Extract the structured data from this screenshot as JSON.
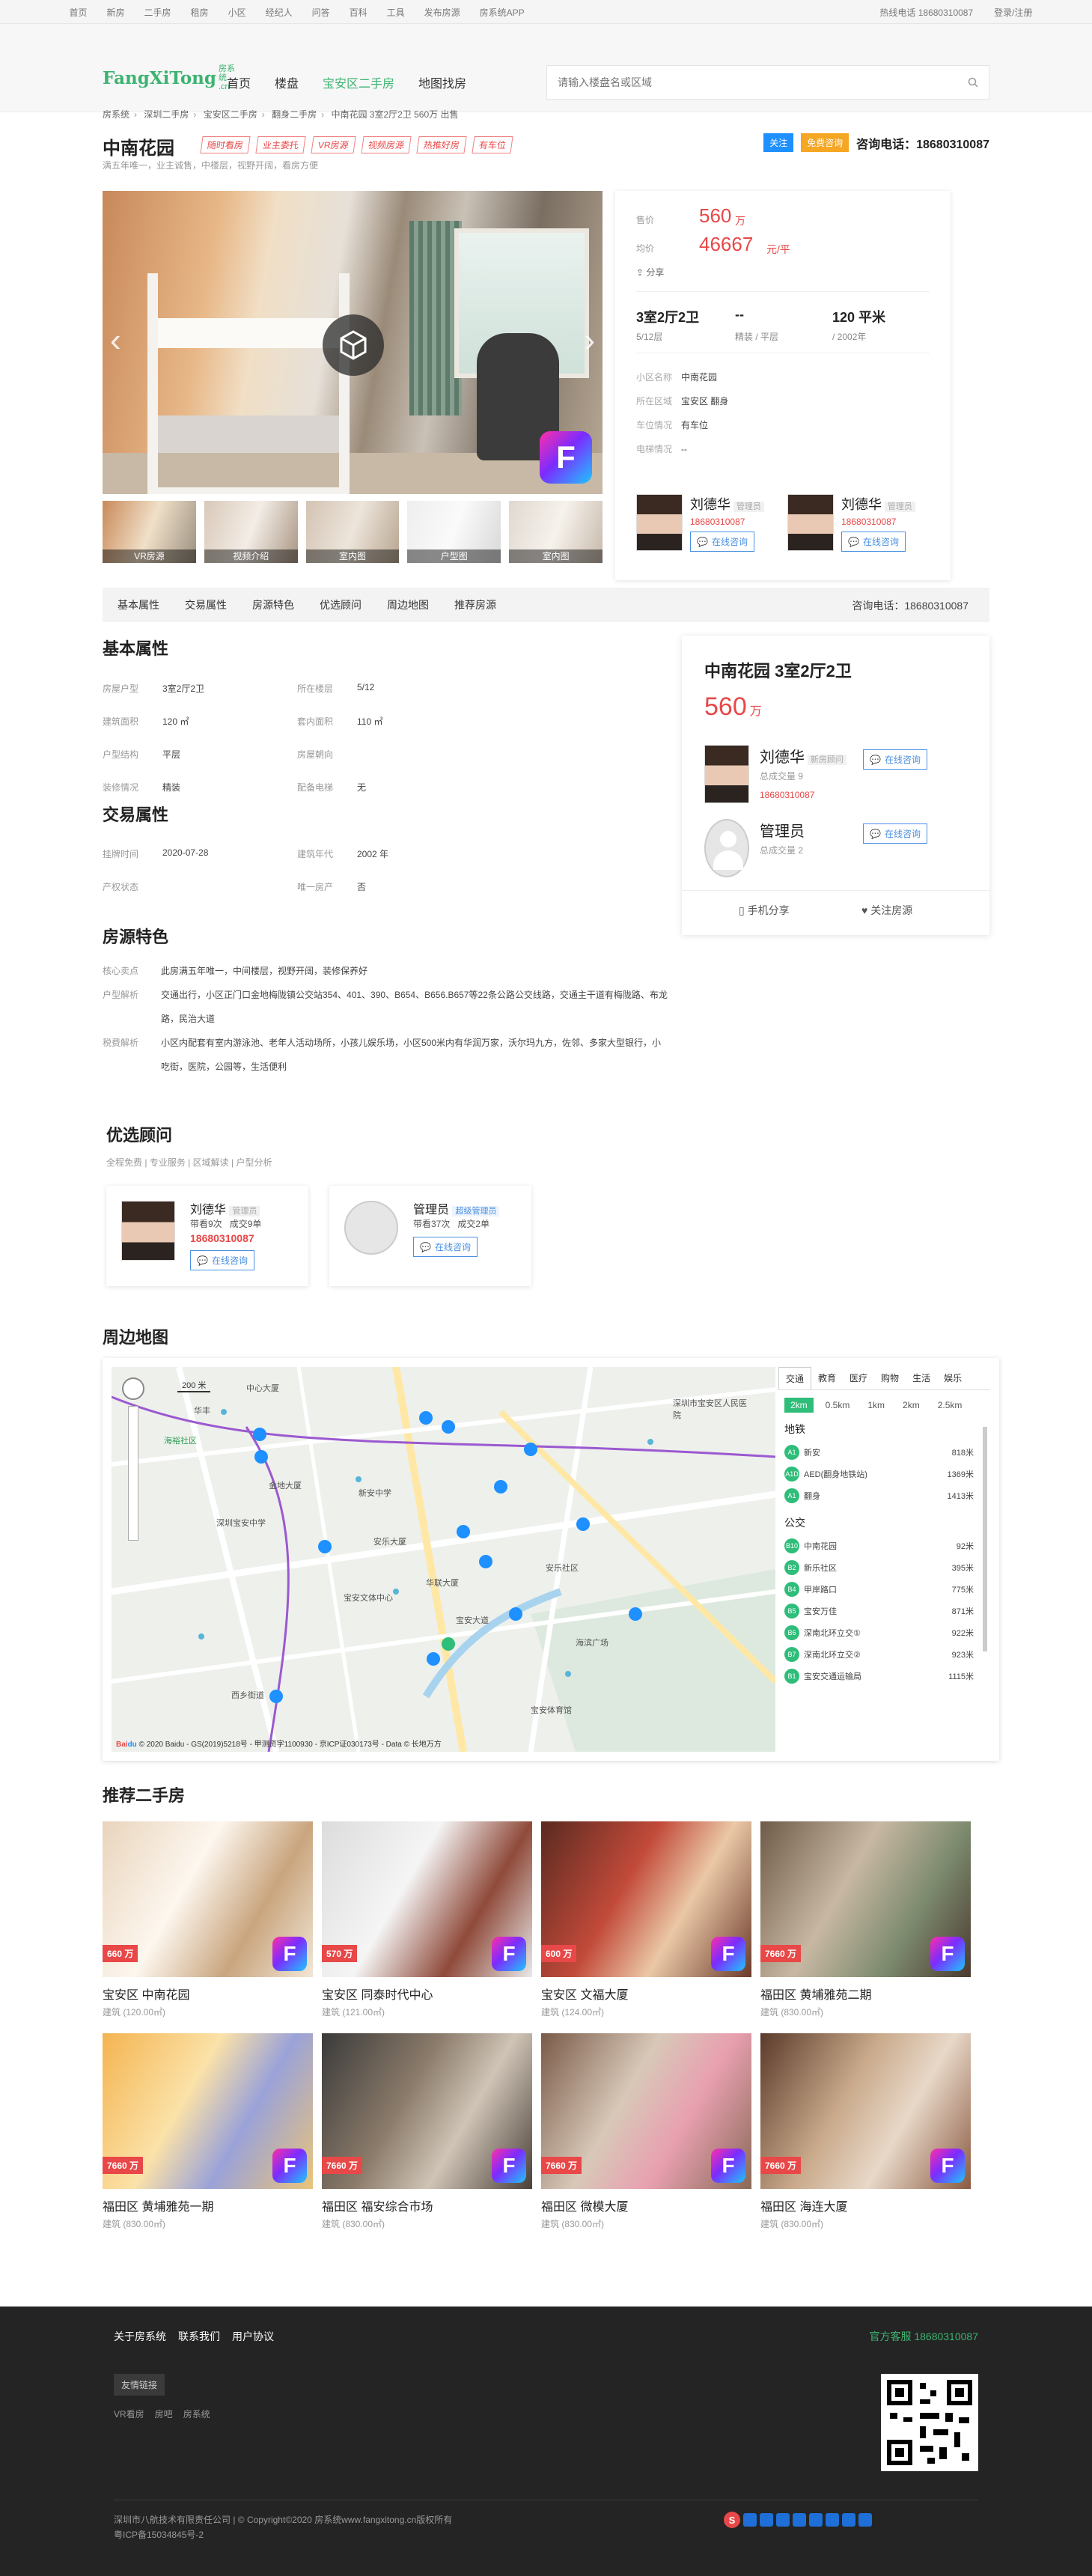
{
  "topbar": {
    "nav": [
      "首页",
      "新房",
      "二手房",
      "租房",
      "小区",
      "经纪人",
      "问答",
      "百科",
      "工具",
      "发布房源",
      "房系统APP"
    ],
    "hotline": "热线电话 18680310087",
    "login": "登录/注册"
  },
  "header": {
    "logo_text": "FangXiTong",
    "logo_cn": "房系统",
    "logo_cn_sub": ".cn",
    "nav": [
      "首页",
      "楼盘",
      "宝安区二手房",
      "地图找房"
    ],
    "search_placeholder": "请输入楼盘名或区域"
  },
  "breadcrumb": [
    "房系统",
    "深圳二手房",
    "宝安区二手房",
    "翻身二手房",
    "中南花园 3室2厅2卫 560万 出售"
  ],
  "title": {
    "name": "中南花园",
    "tags": [
      "随时看房",
      "业主委托",
      "VR房源",
      "视频房源",
      "热推好房",
      "有车位"
    ],
    "subtitle": "满五年唯一，业主诚售，中楼层，视野开阔，看房方便",
    "follow": "关注",
    "free_call": "免费咨询",
    "phone": "咨询电话：18680310087"
  },
  "gallery": {
    "thumbs": [
      "VR房源",
      "视频介绍",
      "室内图",
      "户型图",
      "室内图"
    ]
  },
  "info": {
    "price_label": "售价",
    "price": "560",
    "price_unit": "万",
    "unit_label": "均价",
    "unit_price": "46667",
    "unit_price_unit": "元/平",
    "share": "分享",
    "layout": "3室2厅2卫",
    "layout_sub": "5/12层",
    "decor": "--",
    "decor_sub": "精装 / 平层",
    "area": "120 平米",
    "area_sub": "/ 2002年",
    "fields": [
      {
        "k": "小区名称",
        "v": "中南花园"
      },
      {
        "k": "所在区域",
        "v": "宝安区  翻身"
      },
      {
        "k": "车位情况",
        "v": "有车位"
      },
      {
        "k": "电梯情况",
        "v": "--"
      }
    ],
    "agents": [
      {
        "name": "刘德华",
        "role": "管理员",
        "phone": "18680310087",
        "btn": "在线咨询"
      },
      {
        "name": "刘德华",
        "role": "管理员",
        "phone": "18680310087",
        "btn": "在线咨询"
      }
    ]
  },
  "tabbar": {
    "items": [
      "基本属性",
      "交易属性",
      "房源特色",
      "优选顾问",
      "周边地图",
      "推荐房源"
    ],
    "phone": "咨询电话：18680310087"
  },
  "basic": {
    "title": "基本属性",
    "rows": [
      [
        "房屋户型",
        "3室2厅2卫",
        "所在楼层",
        "5/12"
      ],
      [
        "建筑面积",
        "120 ㎡",
        "套内面积",
        "110 ㎡"
      ],
      [
        "户型结构",
        "平层",
        "房屋朝向",
        ""
      ],
      [
        "装修情况",
        "精装",
        "配备电梯",
        "无"
      ]
    ]
  },
  "trade": {
    "title": "交易属性",
    "rows": [
      [
        "挂牌时间",
        "2020-07-28",
        "建筑年代",
        "2002 年"
      ],
      [
        "产权状态",
        "",
        "唯一房产",
        "否"
      ]
    ]
  },
  "features": {
    "title": "房源特色",
    "rows": [
      {
        "k": "核心卖点",
        "v": "此房满五年唯一，中间楼层，视野开阔，装修保养好"
      },
      {
        "k": "户型解析",
        "v": "交通出行，小区正门口金地梅陇镇公交站354、401、390、B654、B656.B657等22条公路公交线路，交通主干道有梅陇路、布龙路，民治大道"
      },
      {
        "k": "税费解析",
        "v": "小区内配套有室内游泳池、老年人活动场所，小孩儿娱乐场，小区500米内有华润万家，沃尔玛九方，佐邻、多家大型银行，小吃街，医院，公园等，生活便利"
      }
    ]
  },
  "side": {
    "title": "中南花园 3室2厅2卫",
    "price": "560",
    "price_unit": "万",
    "agents": [
      {
        "name": "刘德华",
        "role": "新房顾问",
        "meta": "总成交量 9",
        "phone": "18680310087",
        "btn": "在线咨询"
      },
      {
        "name": "管理员",
        "role": "",
        "meta": "总成交量 2",
        "phone": "",
        "btn": "在线咨询"
      }
    ],
    "share": "手机分享",
    "follow": "关注房源"
  },
  "advisors": {
    "title": "优选顾问",
    "filters": [
      "全程免费",
      "专业服务",
      "区域解读",
      "户型分析"
    ],
    "cards": [
      {
        "name": "刘德华",
        "role": "管理员",
        "m1": "带看9次",
        "m2": "成交9单",
        "phone": "18680310087",
        "btn": "在线咨询"
      },
      {
        "name": "管理员",
        "role": "超级管理员",
        "m1": "带看37次",
        "m2": "成交2单",
        "phone": "",
        "btn": "在线咨询"
      }
    ]
  },
  "map": {
    "title": "周边地图",
    "tabs": [
      "交通",
      "教育",
      "医疗",
      "购物",
      "生活",
      "娱乐"
    ],
    "distances": [
      "2km",
      "0.5km",
      "1km",
      "2km",
      "2.5km"
    ],
    "scale": "200 米",
    "copyright": "© 2020 Baidu - GS(2019)5218号 - 甲测资字1100930 - 京ICP证030173号 - Data © 长地万方",
    "metro_title": "地铁",
    "metro": [
      {
        "b": "A1",
        "n": "新安",
        "d": "818米"
      },
      {
        "b": "A1D",
        "n": "AED(翻身地铁站)",
        "d": "1369米"
      },
      {
        "b": "A1",
        "n": "翻身",
        "d": "1413米"
      }
    ],
    "bus_title": "公交",
    "bus": [
      {
        "b": "B10",
        "n": "中南花园",
        "d": "92米"
      },
      {
        "b": "B2",
        "n": "新乐社区",
        "d": "395米"
      },
      {
        "b": "B4",
        "n": "甲岸路口",
        "d": "775米"
      },
      {
        "b": "B5",
        "n": "宝安万佳",
        "d": "871米"
      },
      {
        "b": "B6",
        "n": "深南北环立交①",
        "d": "922米"
      },
      {
        "b": "B7",
        "n": "深南北环立交②",
        "d": "923米"
      },
      {
        "b": "B1",
        "n": "宝安交通运输局",
        "d": "1115米"
      }
    ],
    "labels": [
      "中心大厦",
      "华丰",
      "深圳市宝安区人民医院",
      "海裕社区",
      "金地大厦",
      "安乐大厦",
      "华联大厦",
      "宝安文体中心",
      "西乡街道",
      "宝安大道",
      "新安中学",
      "安乐社区",
      "深圳宝安中学",
      "海滨广场",
      "宝安体育馆"
    ]
  },
  "recommend": {
    "title": "推荐二手房",
    "items": [
      {
        "price": "660 万",
        "name": "宝安区 中南花园",
        "area": "建筑 (120.00㎡)"
      },
      {
        "price": "570 万",
        "name": "宝安区 同泰时代中心",
        "area": "建筑 (121.00㎡)"
      },
      {
        "price": "600 万",
        "name": "宝安区 文福大厦",
        "area": "建筑 (124.00㎡)"
      },
      {
        "price": "7660 万",
        "name": "福田区 黄埔雅苑二期",
        "area": "建筑 (830.00㎡)"
      },
      {
        "price": "7660 万",
        "name": "福田区 黄埔雅苑一期",
        "area": "建筑 (830.00㎡)"
      },
      {
        "price": "7660 万",
        "name": "福田区 福安综合市场",
        "area": "建筑 (830.00㎡)"
      },
      {
        "price": "7660 万",
        "name": "福田区 微模大厦",
        "area": "建筑 (830.00㎡)"
      },
      {
        "price": "7660 万",
        "name": "福田区 海连大厦",
        "area": "建筑 (830.00㎡)"
      }
    ]
  },
  "footer": {
    "links": [
      "关于房系统",
      "联系我们",
      "用户协议"
    ],
    "service": "官方客服 18680310087",
    "friend_label": "友情链接",
    "friend_links": [
      "VR看房",
      "房吧",
      "房系统"
    ],
    "copyright": "深圳市八航技术有限责任公司 | © Copyright©2020 房系统www.fangxitong.cn版权所有",
    "icp": "粤ICP备15034845号-2"
  }
}
